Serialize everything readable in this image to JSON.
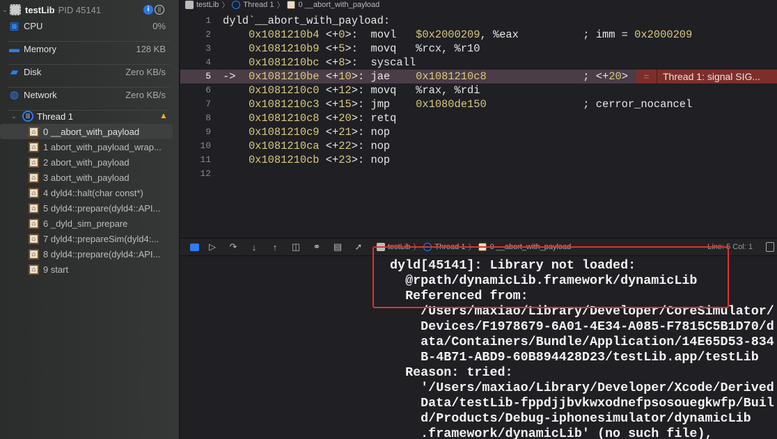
{
  "sidebar": {
    "process": {
      "name": "testLib",
      "pid": "PID 45141"
    },
    "gauges": [
      {
        "label": "CPU",
        "value": "0%",
        "icon": "cpu-icon"
      },
      {
        "label": "Memory",
        "value": "128 KB",
        "icon": "memory-icon"
      },
      {
        "label": "Disk",
        "value": "Zero KB/s",
        "icon": "disk-icon"
      },
      {
        "label": "Network",
        "value": "Zero KB/s",
        "icon": "network-icon"
      }
    ],
    "thread": {
      "label": "Thread 1",
      "warning": "warning-icon"
    },
    "frames": [
      "0 __abort_with_payload",
      "1 abort_with_payload_wrap...",
      "2 abort_with_payload",
      "3 abort_with_payload",
      "4 dyld4::halt(char const*)",
      "5 dyld4::prepare(dyld4::API...",
      "6 _dyld_sim_prepare",
      "7 dyld4::prepareSim(dyld4:...",
      "8 dyld4::prepare(dyld4::API...",
      "9 start"
    ]
  },
  "breadcrumb": [
    "testLib",
    "Thread 1",
    "0 __abort_with_payload"
  ],
  "code": {
    "lines": [
      {
        "n": "1",
        "segs": [
          [
            "w",
            "dyld`__abort_with_payload:"
          ]
        ]
      },
      {
        "n": "2",
        "segs": [
          [
            "y",
            "    0x1081210b4"
          ],
          [
            "w",
            " <+"
          ],
          [
            "y",
            "0"
          ],
          [
            "w",
            ">:  movl   "
          ],
          [
            "y",
            "$0x2000209"
          ],
          [
            "w",
            ", %eax          ; imm = "
          ],
          [
            "y",
            "0x2000209"
          ]
        ]
      },
      {
        "n": "3",
        "segs": [
          [
            "y",
            "    0x1081210b9"
          ],
          [
            "w",
            " <+"
          ],
          [
            "y",
            "5"
          ],
          [
            "w",
            ">:  movq   %rcx, %r10"
          ]
        ]
      },
      {
        "n": "4",
        "segs": [
          [
            "y",
            "    0x1081210bc"
          ],
          [
            "w",
            " <+"
          ],
          [
            "y",
            "8"
          ],
          [
            "w",
            ">:  syscall"
          ]
        ]
      },
      {
        "n": "5",
        "current": true,
        "segs": [
          [
            "w",
            "->  "
          ],
          [
            "y",
            "0x1081210be"
          ],
          [
            "w",
            " <+"
          ],
          [
            "y",
            "10"
          ],
          [
            "w",
            ">: jae    "
          ],
          [
            "y",
            "0x1081210c8"
          ],
          [
            "w",
            "               ; <+"
          ],
          [
            "y",
            "20"
          ],
          [
            "w",
            ">"
          ]
        ]
      },
      {
        "n": "6",
        "segs": [
          [
            "y",
            "    0x1081210c0"
          ],
          [
            "w",
            " <+"
          ],
          [
            "y",
            "12"
          ],
          [
            "w",
            ">: movq   %rax, %rdi"
          ]
        ]
      },
      {
        "n": "7",
        "segs": [
          [
            "y",
            "    0x1081210c3"
          ],
          [
            "w",
            " <+"
          ],
          [
            "y",
            "15"
          ],
          [
            "w",
            ">: jmp    "
          ],
          [
            "y",
            "0x1080de150"
          ],
          [
            "w",
            "               ; cerror_nocancel"
          ]
        ]
      },
      {
        "n": "8",
        "segs": [
          [
            "y",
            "    0x1081210c8"
          ],
          [
            "w",
            " <+"
          ],
          [
            "y",
            "20"
          ],
          [
            "w",
            ">: retq"
          ]
        ]
      },
      {
        "n": "9",
        "segs": [
          [
            "y",
            "    0x1081210c9"
          ],
          [
            "w",
            " <+"
          ],
          [
            "y",
            "21"
          ],
          [
            "w",
            ">: nop"
          ]
        ]
      },
      {
        "n": "10",
        "segs": [
          [
            "y",
            "    0x1081210ca"
          ],
          [
            "w",
            " <+"
          ],
          [
            "y",
            "22"
          ],
          [
            "w",
            ">: nop"
          ]
        ]
      },
      {
        "n": "11",
        "segs": [
          [
            "y",
            "    0x1081210cb"
          ],
          [
            "w",
            " <+"
          ],
          [
            "y",
            "23"
          ],
          [
            "w",
            ">: nop"
          ]
        ]
      },
      {
        "n": "12",
        "segs": []
      }
    ],
    "error_badge": "Thread 1: signal SIG..."
  },
  "debug_bar": {
    "breadcrumb": [
      "testLib",
      "Thread 1",
      "0 __abort_with_payload"
    ],
    "position": "Line: 5  Col: 1"
  },
  "console": {
    "lines": [
      "dyld[45141]: Library not loaded:",
      "  @rpath/dynamicLib.framework/dynamicLib",
      "  Referenced from:",
      "    /Users/maxiao/Library/Developer/CoreSimulator/",
      "    Devices/F1978679-6A01-4E34-A085-F7815C5B1D70/d",
      "    ata/Containers/Bundle/Application/14E65D53-834",
      "    B-4B71-ABD9-60B894428D23/testLib.app/testLib",
      "  Reason: tried:",
      "    '/Users/maxiao/Library/Developer/Xcode/Derived",
      "    Data/testLib-fppdjjbvkwxodnefpsosouegkwfp/Buil",
      "    d/Products/Debug-iphonesimulator/dynamicLib",
      "    .framework/dynamicLib' (no such file),"
    ]
  }
}
